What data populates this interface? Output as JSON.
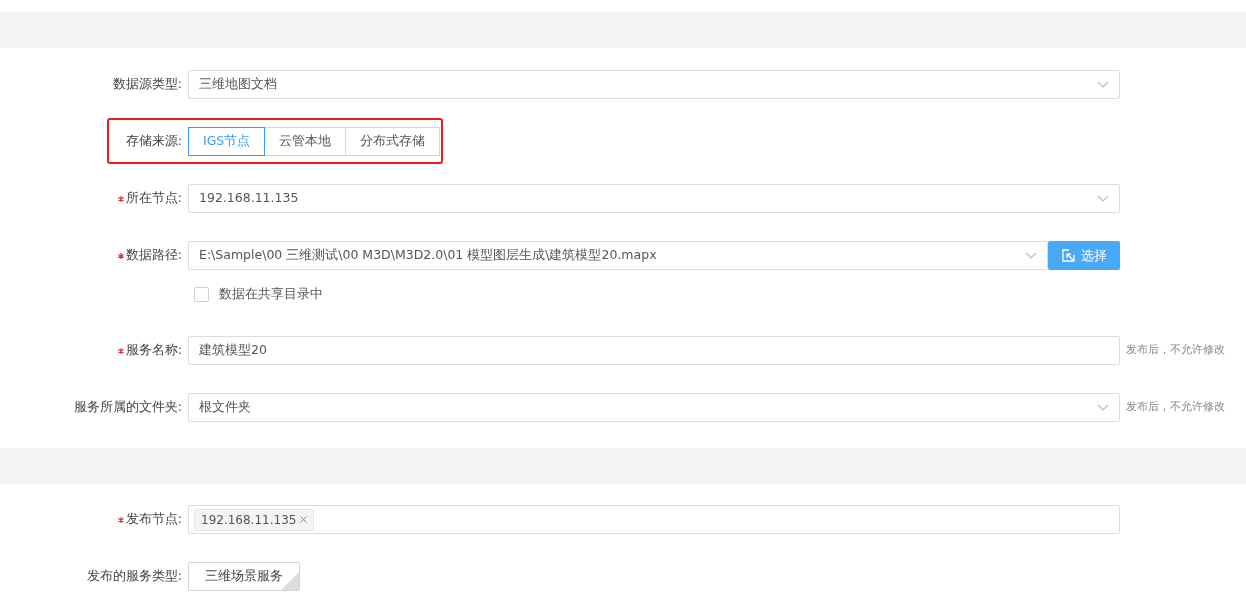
{
  "sections": [
    {
      "rows": [
        {
          "kind": "select",
          "label": "数据源类型:",
          "required": false,
          "value": "三维地图文档"
        },
        {
          "kind": "segmented",
          "label": "存储来源:",
          "required": false,
          "highlighted": true,
          "options": [
            {
              "label": "IGS节点",
              "selected": true
            },
            {
              "label": "云管本地",
              "selected": false
            },
            {
              "label": "分布式存储",
              "selected": false
            }
          ]
        },
        {
          "kind": "select",
          "label": "所在节点:",
          "required": true,
          "value": "192.168.11.135"
        },
        {
          "kind": "path",
          "label": "数据路径:",
          "required": true,
          "value": "E:\\Sample\\00 三维测试\\00 M3D\\M3D2.0\\01 模型图层生成\\建筑模型20.mapx",
          "button": "选择",
          "checkbox": {
            "label": "数据在共享目录中",
            "checked": false
          }
        },
        {
          "kind": "input",
          "label": "服务名称:",
          "required": true,
          "value": "建筑模型20",
          "hint": "发布后，不允许修改"
        },
        {
          "kind": "select",
          "label": "服务所属的文件夹:",
          "required": false,
          "value": "根文件夹",
          "hint": "发布后，不允许修改"
        }
      ]
    },
    {
      "rows": [
        {
          "kind": "tags",
          "label": "发布节点:",
          "required": true,
          "tags": [
            "192.168.11.135"
          ]
        },
        {
          "kind": "choice",
          "label": "发布的服务类型:",
          "required": false,
          "options": [
            {
              "label": "三维场景服务",
              "selected": true
            }
          ]
        }
      ]
    }
  ]
}
